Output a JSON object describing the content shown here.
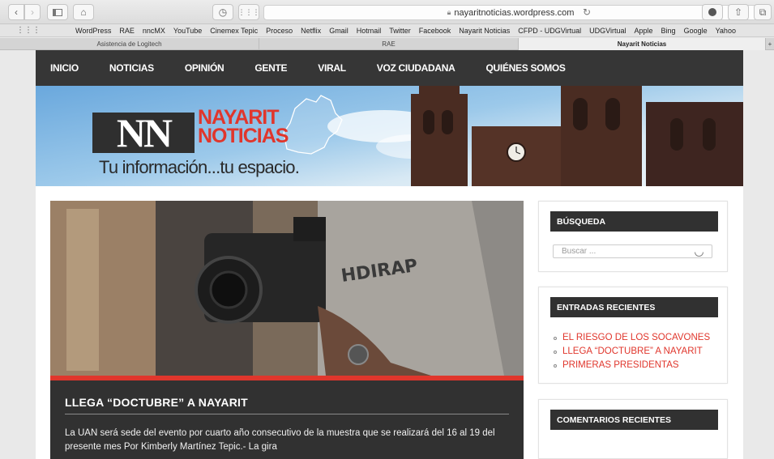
{
  "browser": {
    "url": "nayaritnoticias.wordpress.com",
    "bookmarks": [
      "WordPress",
      "RAE",
      "nncMX",
      "YouTube",
      "Cinemex Tepic",
      "Proceso",
      "Netflix",
      "Gmail",
      "Hotmail",
      "Twitter",
      "Facebook",
      "Nayarit Noticias",
      "CFPD - UDGVirtual",
      "UDGVirtual",
      "Apple",
      "Bing",
      "Google",
      "Yahoo"
    ],
    "tabs": [
      {
        "label": "Asistencia de Logitech",
        "active": false
      },
      {
        "label": "RAE",
        "active": false
      },
      {
        "label": "Nayarit Noticias",
        "active": true
      }
    ]
  },
  "nav": {
    "items": [
      "INICIO",
      "NOTICIAS",
      "OPINIÓN",
      "GENTE",
      "VIRAL",
      "VOZ CIUDADANA",
      "QUIÉNES SOMOS"
    ]
  },
  "banner": {
    "logo_initials": "NN",
    "logo_line1": "NAYARIT",
    "logo_line2": "NOTICIAS",
    "tagline": "Tu información...tu espacio."
  },
  "post": {
    "title": "LLEGA “DOCTUBRE” A NAYARIT",
    "excerpt": "La UAN será sede del evento por cuarto año consecutivo de la muestra que se realizará del 16 al 19 del presente mes   Por Kimberly Martínez Tepic.- La gira"
  },
  "sidebar": {
    "search": {
      "title": "BÚSQUEDA",
      "placeholder": "Buscar ..."
    },
    "recent": {
      "title": "ENTRADAS RECIENTES",
      "items": [
        "EL RIESGO DE LOS SOCAVONES",
        "LLEGA “DOCTUBRE” A NAYARIT",
        "PRIMERAS PRESIDENTAS"
      ]
    },
    "comments": {
      "title": "COMENTARIOS RECIENTES"
    }
  },
  "colors": {
    "accent": "#e0362c",
    "dark": "#313131",
    "nav": "#363636"
  }
}
